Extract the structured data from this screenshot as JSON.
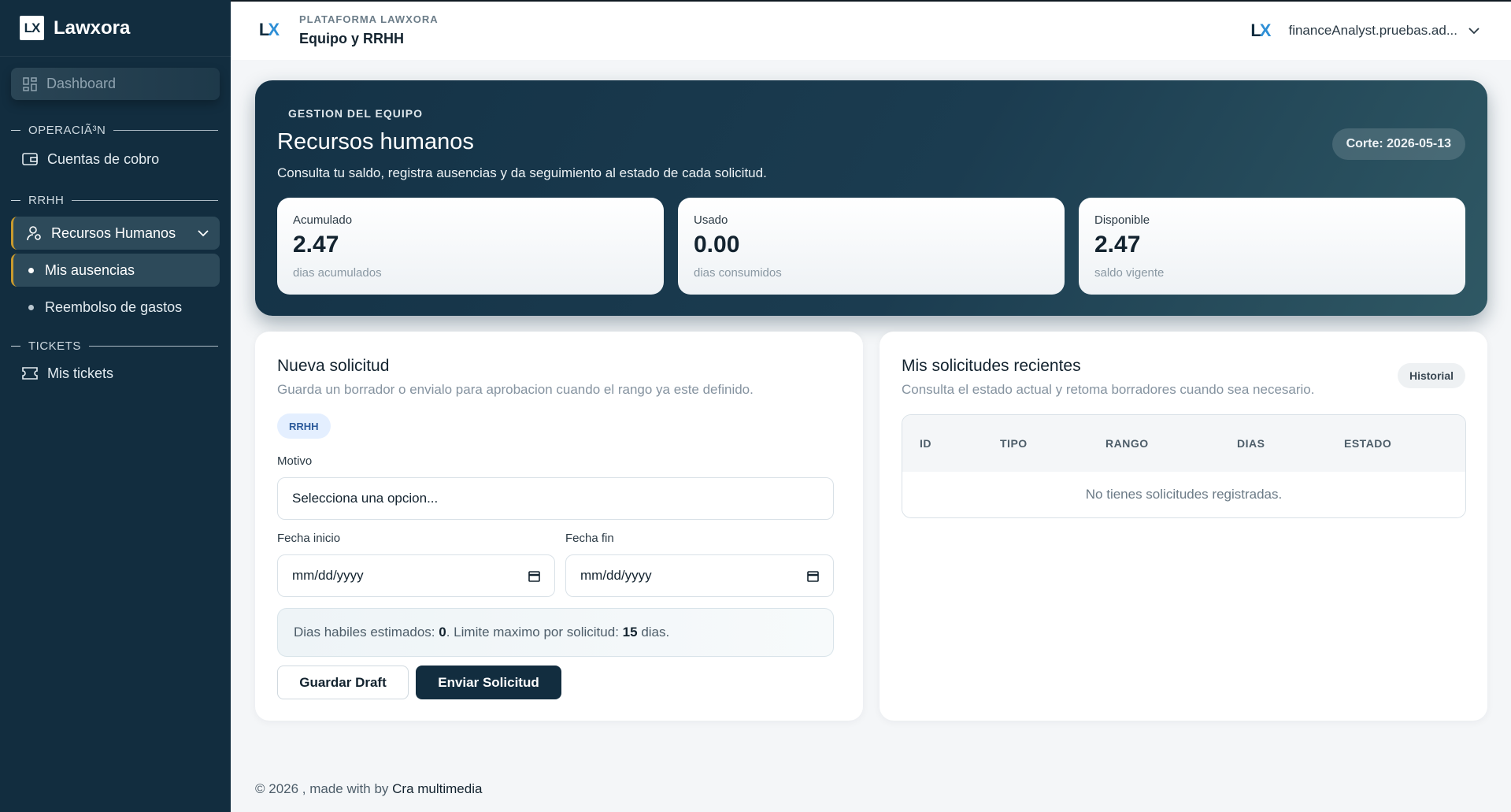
{
  "brand": {
    "logo": "LX",
    "name": "Lawxora"
  },
  "sidebar": {
    "dashboard": "Dashboard",
    "sections": {
      "operacion": "OPERACIÃ³N",
      "rrhh": "RRHH",
      "tickets": "TICKETS"
    },
    "items": {
      "cuentas": "Cuentas de cobro",
      "recursos": "Recursos Humanos",
      "ausencias": "Mis ausencias",
      "reembolso": "Reembolso de gastos",
      "tickets": "Mis tickets"
    }
  },
  "header": {
    "kicker": "PLATAFORMA LAWXORA",
    "title": "Equipo y RRHH",
    "user": "financeAnalyst.pruebas.ad..."
  },
  "hero": {
    "kicker": "GESTION DEL EQUIPO",
    "title": "Recursos humanos",
    "description": "Consulta tu saldo, registra ausencias y da seguimiento al estado de cada solicitud.",
    "badge": "Corte: 2026-05-13",
    "stats": [
      {
        "label": "Acumulado",
        "value": "2.47",
        "sub": "dias acumulados"
      },
      {
        "label": "Usado",
        "value": "0.00",
        "sub": "dias consumidos"
      },
      {
        "label": "Disponible",
        "value": "2.47",
        "sub": "saldo vigente"
      }
    ]
  },
  "form": {
    "title": "Nueva solicitud",
    "description": "Guarda un borrador o envialo para aprobacion cuando el rango ya este definido.",
    "chip": "RRHH",
    "motivo_label": "Motivo",
    "motivo_value": "Selecciona una opcion...",
    "inicio_label": "Fecha inicio",
    "inicio_value": "mm/dd/yyyy",
    "fin_label": "Fecha fin",
    "fin_value": "mm/dd/yyyy",
    "info_prefix": "Dias habiles estimados: ",
    "info_days": "0",
    "info_middle": ". Limite maximo por solicitud: ",
    "info_limit": "15",
    "info_suffix": " dias.",
    "save_label": "Guardar Draft",
    "send_label": "Enviar Solicitud"
  },
  "recent": {
    "title": "Mis solicitudes recientes",
    "description": "Consulta el estado actual y retoma borradores cuando sea necesario.",
    "badge": "Historial",
    "columns": [
      "ID",
      "TIPO",
      "RANGO",
      "DIAS",
      "ESTADO"
    ],
    "empty": "No tienes solicitudes registradas."
  },
  "footer": {
    "prefix": "© 2026 , made with by ",
    "credit": "Cra multimedia"
  },
  "colors": {
    "sidebar": "#122d3f",
    "accent": "#c89a2e",
    "primary": "#122d3f",
    "link": "#2e8fd6"
  }
}
